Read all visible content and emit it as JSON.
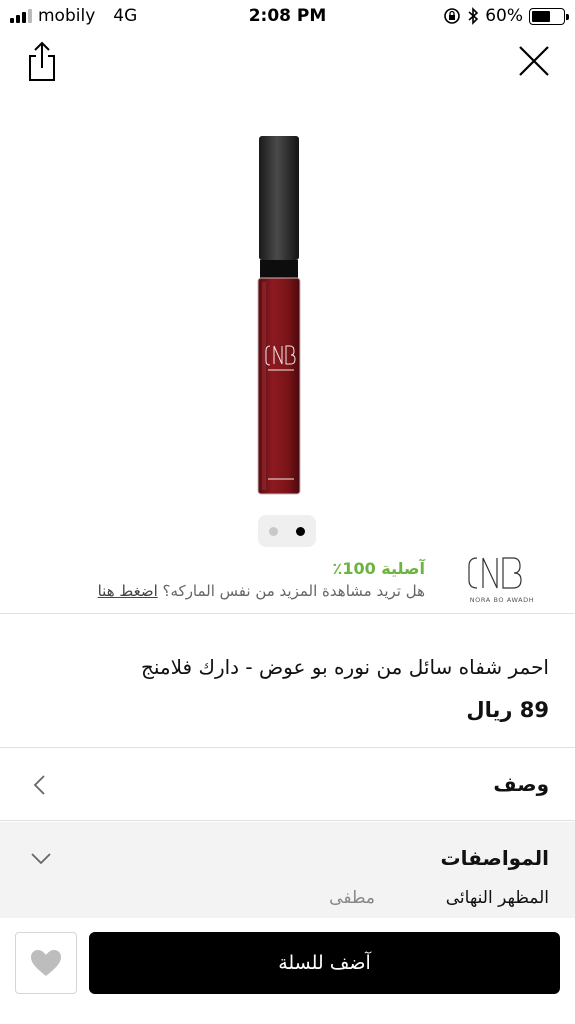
{
  "status_bar": {
    "carrier": "mobily",
    "network": "4G",
    "time": "2:08 PM",
    "battery": "60%",
    "battery_level": 0.6
  },
  "icons": {
    "share": "share-icon",
    "close": "close-icon",
    "heart": "heart-icon",
    "chevron_left": "chevron-left-icon",
    "chevron_down": "chevron-down-icon"
  },
  "gallery": {
    "image_count": 2,
    "active_index": 1
  },
  "brand": {
    "authentic_label": "آصلية 100٪",
    "more_text": "هل تريد مشاهدة المزيد من نفس الماركه؟",
    "press_here": "اضغط هنا",
    "logo_caption": "NORA BO AWADH"
  },
  "product": {
    "title": "احمر شفاه سائل من نوره بو عوض - دارك فلامنج",
    "price": "89 ريال"
  },
  "sections": {
    "description": "وصف",
    "specifications": "المواصفات",
    "specs": [
      {
        "key": "المظهر النهائى",
        "value": "مطفى"
      }
    ]
  },
  "actions": {
    "add_to_cart": "آضف للسلة"
  },
  "colors": {
    "accent_green": "#6cb33f",
    "button_black": "#000000",
    "lipstick_red": "#7a1418"
  }
}
